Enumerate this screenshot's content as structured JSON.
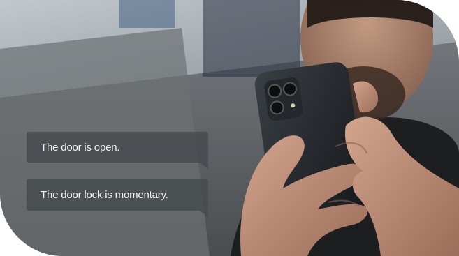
{
  "messages": [
    {
      "text": "The door is open."
    },
    {
      "text": "The door lock is momentary."
    }
  ],
  "colors": {
    "bubble_background": "#464a4e",
    "bubble_text": "#f2f2f2",
    "phone_body": "#1e2124",
    "background_wall": "#8a8d8f"
  }
}
